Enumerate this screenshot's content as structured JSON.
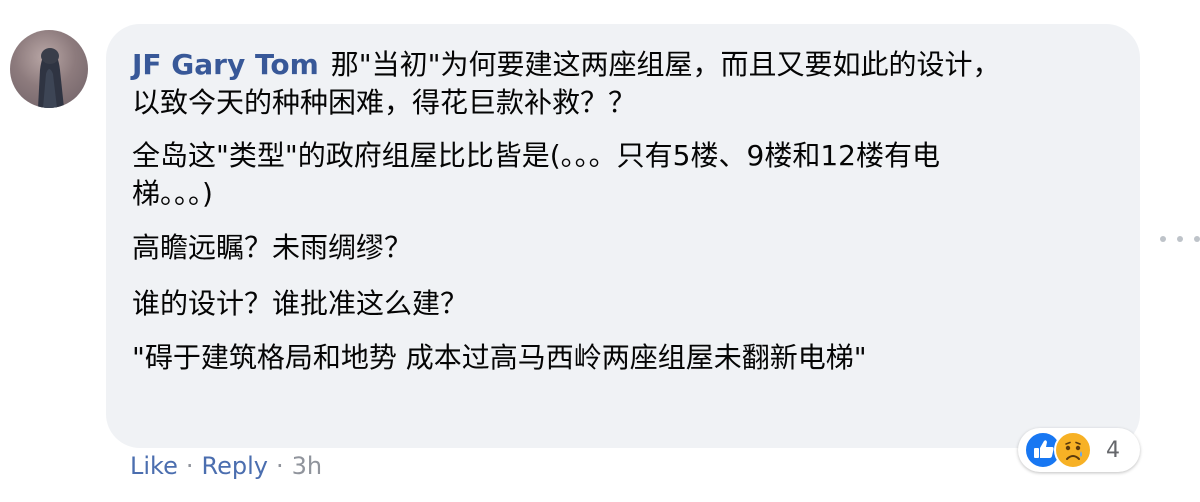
{
  "comment": {
    "author": "JF Gary Tom",
    "lines": [
      "那\"当初\"为何要建这两座组屋，而且又要如此的设计，",
      "以致今天的种种困难，得花巨款补救？？"
    ],
    "paragraphs": [
      [
        "全岛这\"类型\"的政府组屋比比皆是(。。。只有5楼、9楼和12楼有电",
        "梯。。。)"
      ],
      [
        "高瞻远瞩？未雨绸缪？"
      ],
      [
        "谁的设计？谁批准这么建？"
      ],
      [
        "\"碍于建筑格局和地势 成本过高马西岭两座组屋未翻新电梯\""
      ]
    ],
    "reactions": {
      "icons": [
        "like-icon",
        "sad-icon"
      ],
      "count": "4"
    }
  },
  "actions": {
    "like": "Like",
    "reply": "Reply",
    "separator": "·",
    "time": "3h"
  },
  "colors": {
    "author": "#385898",
    "bubble": "#f0f2f5",
    "like": "#1877f2",
    "sad": "#f7b125",
    "action_link": "#4b6eaf",
    "muted": "#90949c"
  }
}
